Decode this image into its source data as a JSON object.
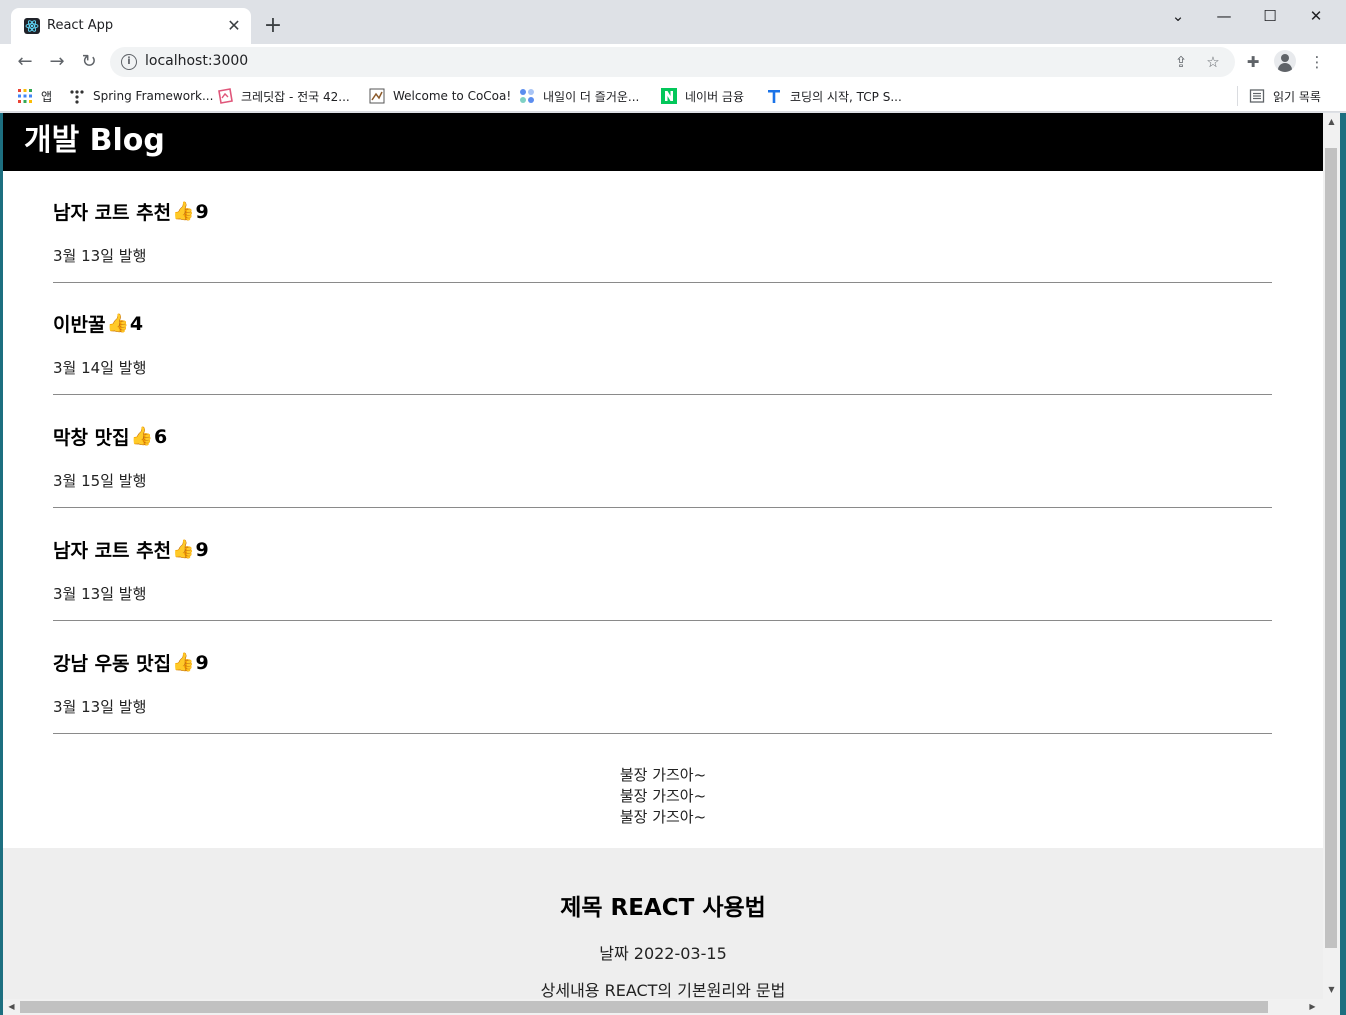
{
  "browser": {
    "tab_title": "React App",
    "tab_close": "✕",
    "new_tab": "+",
    "url": "localhost:3000",
    "window_controls": {
      "menu": "⌄",
      "minimize": "—",
      "maximize": "☐",
      "close": "✕"
    }
  },
  "bookmarks": [
    {
      "label": "앱",
      "icon": "apps-grid-icon"
    },
    {
      "label": "Spring Framework...",
      "icon": "spring-icon"
    },
    {
      "label": "크레딧잡 - 전국 42...",
      "icon": "kreditjob-icon"
    },
    {
      "label": "Welcome to CoCoa!",
      "icon": "cocoa-icon"
    },
    {
      "label": "내일이 더 즐거운...",
      "icon": "dots-icon"
    },
    {
      "label": "네이버 금융",
      "icon": "naver-icon"
    },
    {
      "label": "코딩의 시작, TCP S...",
      "icon": "tcp-icon"
    },
    {
      "label": "읽기 목록",
      "icon": "reading-list-icon"
    }
  ],
  "blog": {
    "title": "개발 Blog",
    "posts": [
      {
        "title": "남자 코트 추천",
        "likes": "9",
        "date": "3월 13일 발행"
      },
      {
        "title": "이반꿀",
        "likes": "4",
        "date": "3월 14일 발행"
      },
      {
        "title": "막창 맛집",
        "likes": "6",
        "date": "3월 15일 발행"
      },
      {
        "title": "남자 코트 추천",
        "likes": "9",
        "date": "3월 13일 발행"
      },
      {
        "title": "강남 우동 맛집",
        "likes": "9",
        "date": "3월 13일 발행"
      }
    ],
    "repeat_lines": [
      "불장 가즈아~",
      "불장 가즈아~",
      "불장 가즈아~"
    ],
    "like_icon": "👍",
    "modal": {
      "title": "제목 REACT 사용법",
      "date": "날짜 2022-03-15",
      "detail": "상세내용 REACT의 기본원리와 문법"
    }
  },
  "colors": {
    "nav_bg": "#000000",
    "modal_bg": "#eeeeee",
    "thumb": "#f4b400"
  }
}
